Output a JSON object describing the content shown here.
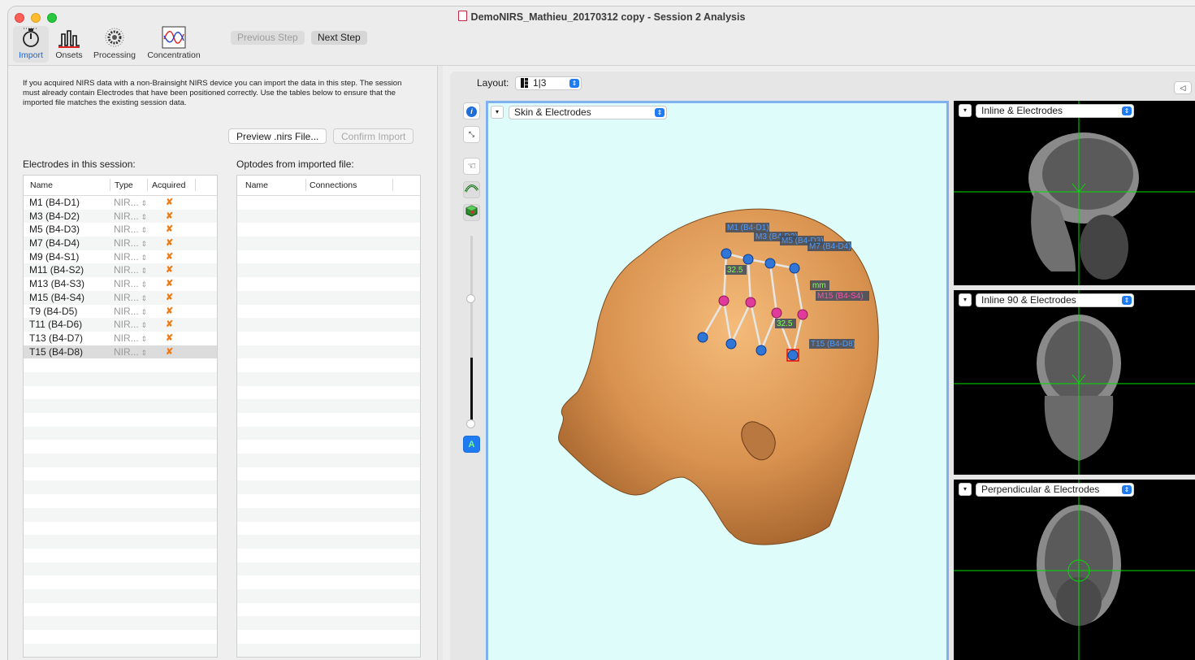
{
  "window": {
    "title": "DemoNIRS_Mathieu_20170312 copy - Session 2 Analysis"
  },
  "toolbar": {
    "import_label": "Import",
    "onsets_label": "Onsets",
    "processing_label": "Processing",
    "concentration_label": "Concentration",
    "previous_step_label": "Previous Step",
    "next_step_label": "Next Step"
  },
  "import_panel": {
    "info_text": "If you acquired NIRS data with a non-Brainsight NIRS device you can import the data in this step. The session must already contain Electrodes that have been positioned correctly. Use the tables below to ensure that the imported file matches the existing session data.",
    "preview_button": "Preview .nirs File...",
    "confirm_button": "Confirm Import",
    "electrodes_label": "Electrodes in this session:",
    "optodes_label": "Optodes from imported file:",
    "electrode_columns": [
      "Name",
      "Type",
      "Acquired"
    ],
    "optode_columns": [
      "Name",
      "Connections"
    ],
    "electrodes": [
      {
        "name": "M1 (B4-D1)",
        "type": "NIR...",
        "acquired": "✘"
      },
      {
        "name": "M3 (B4-D2)",
        "type": "NIR...",
        "acquired": "✘"
      },
      {
        "name": "M5 (B4-D3)",
        "type": "NIR...",
        "acquired": "✘"
      },
      {
        "name": "M7 (B4-D4)",
        "type": "NIR...",
        "acquired": "✘"
      },
      {
        "name": "M9 (B4-S1)",
        "type": "NIR...",
        "acquired": "✘"
      },
      {
        "name": "M11 (B4-S2)",
        "type": "NIR...",
        "acquired": "✘"
      },
      {
        "name": "M13 (B4-S3)",
        "type": "NIR...",
        "acquired": "✘"
      },
      {
        "name": "M15 (B4-S4)",
        "type": "NIR...",
        "acquired": "✘"
      },
      {
        "name": "T9 (B4-D5)",
        "type": "NIR...",
        "acquired": "✘"
      },
      {
        "name": "T11 (B4-D6)",
        "type": "NIR...",
        "acquired": "✘"
      },
      {
        "name": "T13 (B4-D7)",
        "type": "NIR...",
        "acquired": "✘"
      },
      {
        "name": "T15 (B4-D8)",
        "type": "NIR...",
        "acquired": "✘"
      }
    ]
  },
  "viewer": {
    "layout_label": "Layout:",
    "layout_value": "1|3",
    "main_view": "Skin & Electrodes",
    "view_top": "Inline & Electrodes",
    "view_middle": "Inline 90 & Electrodes",
    "view_bottom": "Perpendicular & Electrodes",
    "scene_labels": [
      "M1 (B4-D1)",
      "M3 (B4-D2)",
      "M5 (B4-D3)",
      "M7 (B4-D4)",
      "M15 (B4-S4)",
      "T15 (B4-D8)",
      "32.5",
      "mm"
    ],
    "colors": {
      "accent": "#1e7bf2",
      "viewport_bg": "#ddfcfa",
      "skin": "#d9924f",
      "source_marker": "#e03a9a",
      "detector_marker": "#2f76d6",
      "crosshair": "#00e000",
      "acquired_x": "#f07b14"
    }
  }
}
